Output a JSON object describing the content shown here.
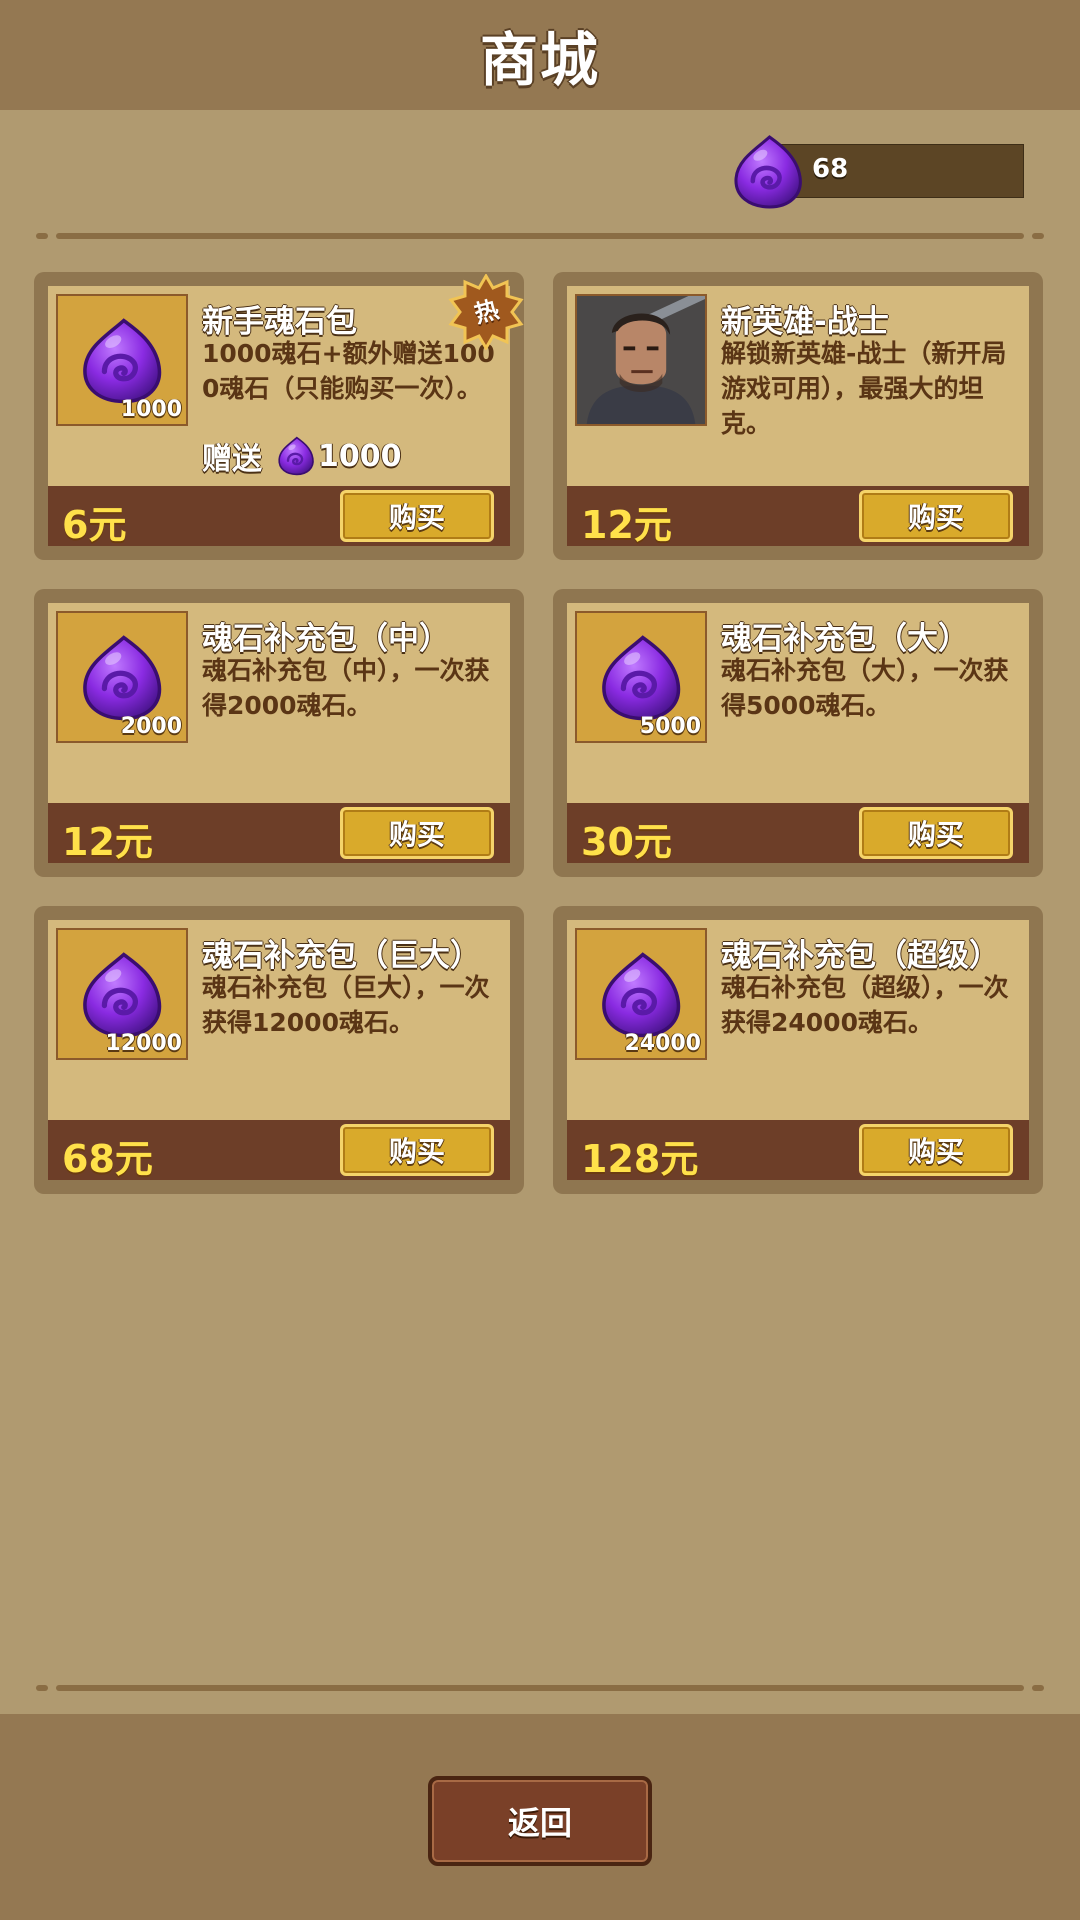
{
  "header": {
    "title": "商城"
  },
  "currency": {
    "icon": "soul-stone-icon",
    "amount": "68"
  },
  "products": [
    {
      "title": "新手魂石包",
      "description": "1000魂石+额外赠送1000魂石（只能购买一次）。",
      "icon": "soul-stone-icon",
      "quantity": "1000",
      "badge": "热",
      "bonus_label": "赠送",
      "bonus_amount": "1000",
      "price": "6元",
      "buy_label": "购买"
    },
    {
      "title": "新英雄-战士",
      "description": "解锁新英雄-战士（新开局游戏可用），最强大的坦克。",
      "icon": "warrior-portrait",
      "price": "12元",
      "buy_label": "购买"
    },
    {
      "title": "魂石补充包（中）",
      "description": "魂石补充包（中），一次获得2000魂石。",
      "icon": "soul-stone-icon",
      "quantity": "2000",
      "price": "12元",
      "buy_label": "购买"
    },
    {
      "title": "魂石补充包（大）",
      "description": "魂石补充包（大），一次获得5000魂石。",
      "icon": "soul-stone-icon",
      "quantity": "5000",
      "price": "30元",
      "buy_label": "购买"
    },
    {
      "title": "魂石补充包（巨大）",
      "description": "魂石补充包（巨大），一次获得12000魂石。",
      "icon": "soul-stone-icon",
      "quantity": "12000",
      "price": "68元",
      "buy_label": "购买"
    },
    {
      "title": "魂石补充包（超级）",
      "description": "魂石补充包（超级），一次获得24000魂石。",
      "icon": "soul-stone-icon",
      "quantity": "24000",
      "price": "128元",
      "buy_label": "购买"
    }
  ],
  "footer": {
    "back_label": "返回"
  },
  "colors": {
    "price": "#ffe14a",
    "buy_button": "#d9aa2b",
    "panel": "#d4b97d",
    "price_bar": "#6d3e28"
  }
}
